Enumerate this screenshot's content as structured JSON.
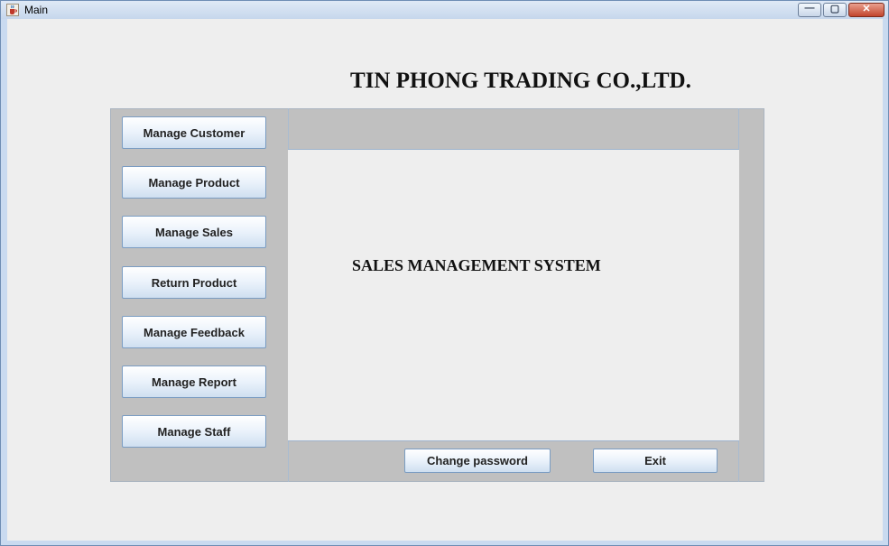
{
  "window": {
    "title": "Main",
    "controls": {
      "minimize": "—",
      "maximize": "▢",
      "close": "✕"
    }
  },
  "header": {
    "company": "TIN PHONG TRADING CO.,LTD."
  },
  "main": {
    "system_title": "SALES MANAGEMENT SYSTEM"
  },
  "sidebar": {
    "buttons": [
      {
        "label": "Manage Customer"
      },
      {
        "label": "Manage Product"
      },
      {
        "label": "Manage Sales"
      },
      {
        "label": "Return Product"
      },
      {
        "label": "Manage Feedback"
      },
      {
        "label": "Manage Report"
      },
      {
        "label": "Manage Staff"
      }
    ]
  },
  "footer": {
    "change_password_label": "Change password",
    "exit_label": "Exit"
  },
  "colors": {
    "panel": "#c0c0c0",
    "client_background": "#eeeeee",
    "button_border": "#7a9cc2",
    "close_button": "#c2442c"
  },
  "icons": {
    "app": "java-cup-icon"
  }
}
